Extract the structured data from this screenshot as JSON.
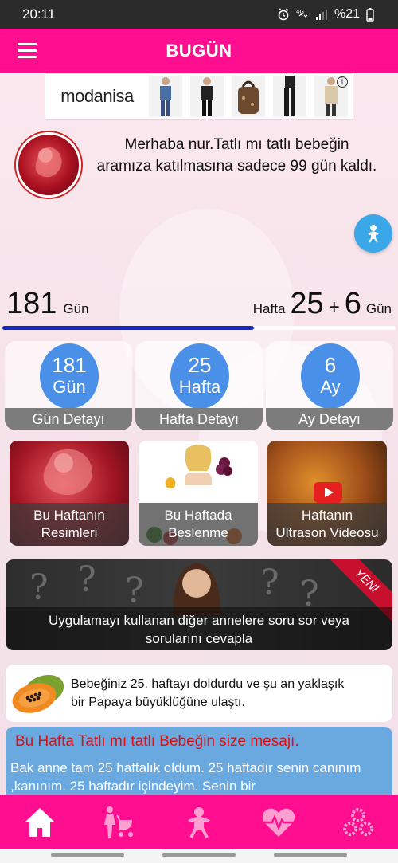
{
  "status": {
    "time": "20:11",
    "battery": "%21"
  },
  "appbar": {
    "title": "BUGÜN"
  },
  "ad": {
    "brand": "modanisa"
  },
  "greeting": "Merhaba nur.Tatlı mı tatlı bebeğin aramıza katılmasına sadece 99 gün kaldı.",
  "counter": {
    "days": "181",
    "days_label": "Gün",
    "week_label": "Hafta",
    "week": "25",
    "plus": "+",
    "extra_days": "6",
    "extra_days_label": "Gün",
    "progress_fraction": 0.64
  },
  "cards": [
    {
      "value": "181",
      "unit": "Gün",
      "label": "Gün Detayı"
    },
    {
      "value": "25",
      "unit": "Hafta",
      "label": "Hafta Detayı"
    },
    {
      "value": "6",
      "unit": "Ay",
      "label": "Ay Detayı"
    }
  ],
  "tiles": [
    {
      "line1": "Bu Haftanın",
      "line2": "Resimleri"
    },
    {
      "line1": "Bu Haftada",
      "line2": "Beslenme"
    },
    {
      "line1": "Haftanın",
      "line2": "Ultrason Videosu"
    }
  ],
  "question_banner": {
    "badge": "YENİ",
    "line1": "Uygulamayı kullanan diğer annelere soru sor veya",
    "line2": "sorularını cevapla"
  },
  "papaya": {
    "line1": "Bebeğiniz 25. haftayı doldurdu ve şu an yaklaşık",
    "line2": "bir Papaya büyüklüğüne ulaştı."
  },
  "message": {
    "title": "Bu Hafta Tatlı mı tatlı Bebeğin size mesajı.",
    "body": "Bak anne tam 25 haftalık oldum. 25 haftadır senin canınım ,kanınım. 25 haftadır içindeyim. Senin bir"
  },
  "bottom_nav": [
    {
      "icon": "home-icon"
    },
    {
      "icon": "mother-stroller-icon"
    },
    {
      "icon": "baby-icon"
    },
    {
      "icon": "heartbeat-icon"
    },
    {
      "icon": "settings-gears-icon"
    }
  ],
  "colors": {
    "primary": "#ff0f8f",
    "accent_blue": "#4a90e8",
    "progress": "#1626c8"
  }
}
